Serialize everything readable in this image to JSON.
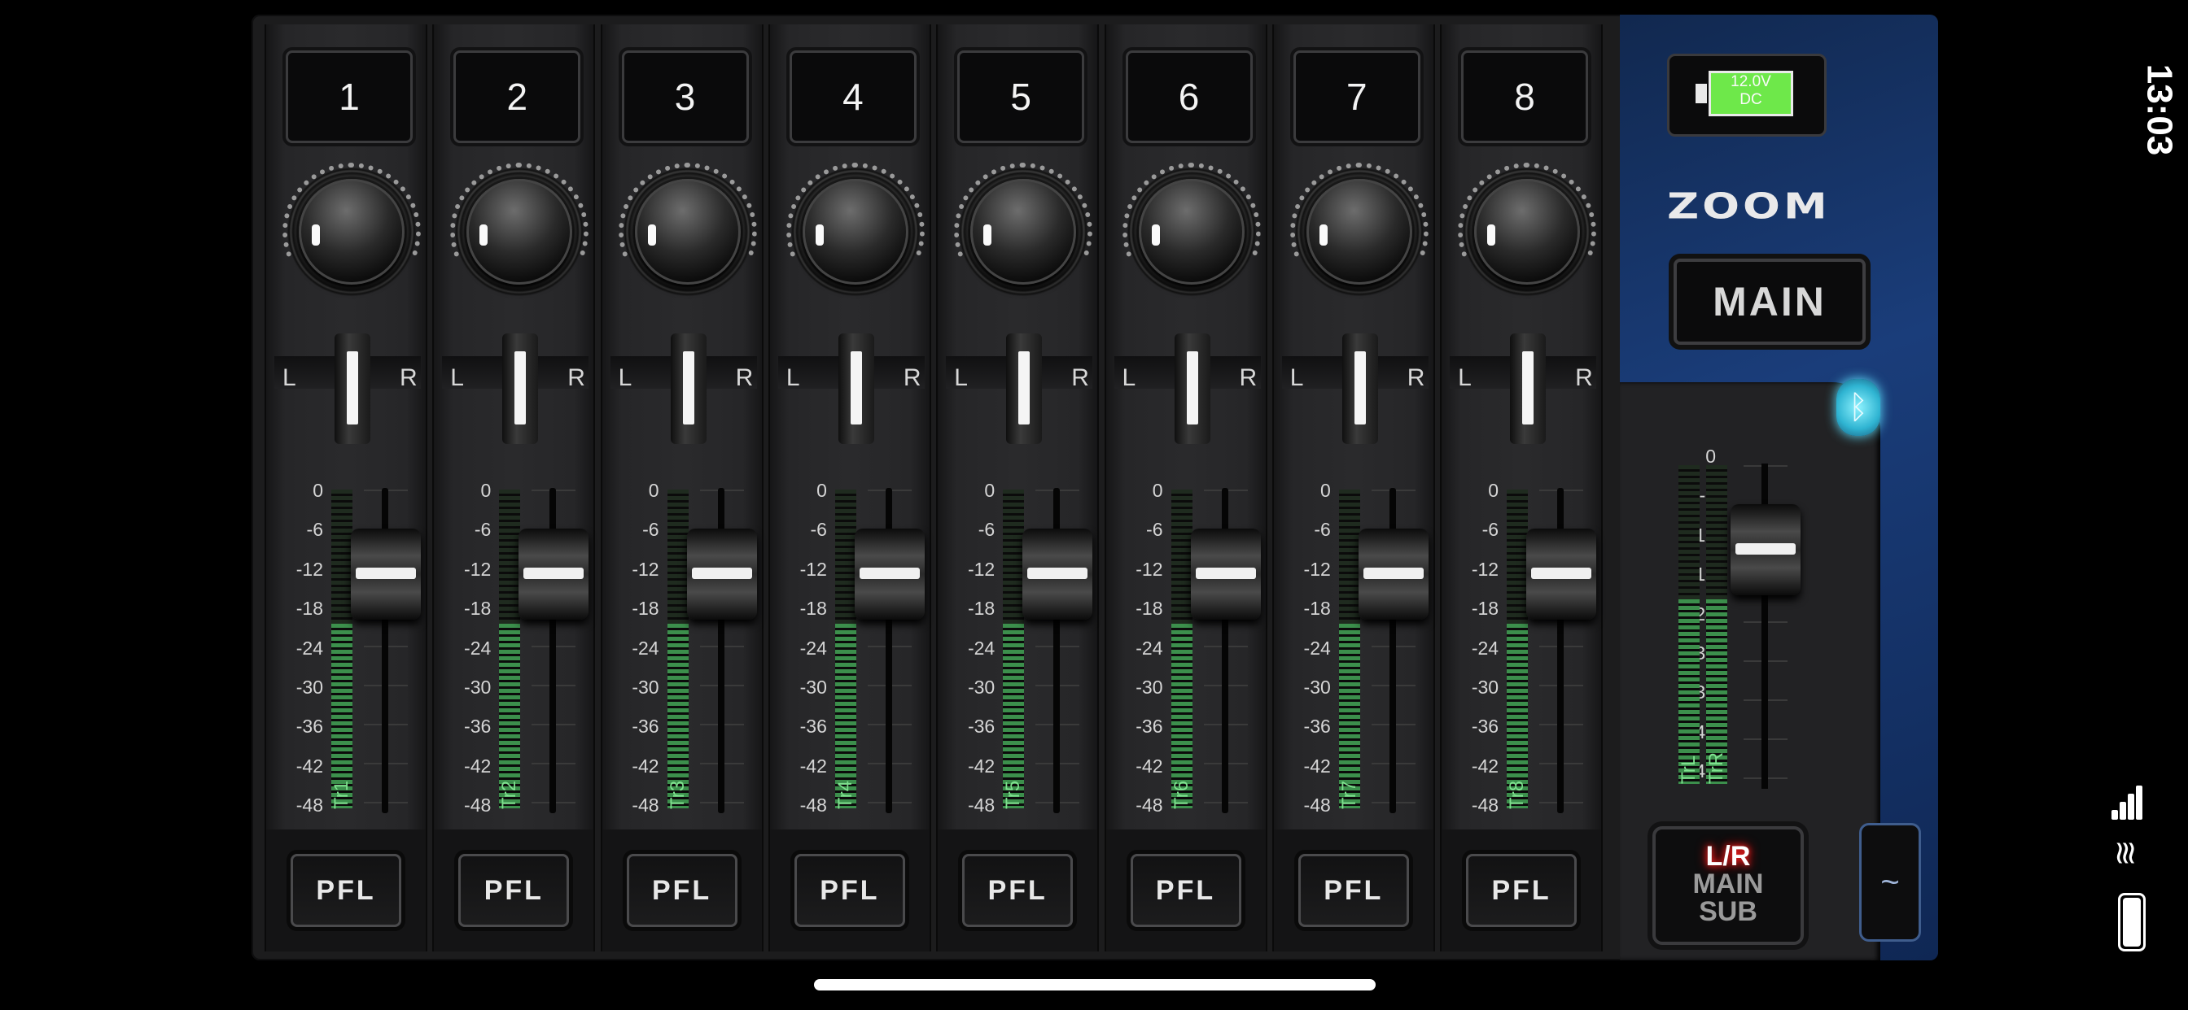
{
  "channels": [
    {
      "name": "1",
      "track": "Tr1",
      "fader_level": 0.2
    },
    {
      "name": "2",
      "track": "Tr2",
      "fader_level": 0.2
    },
    {
      "name": "3",
      "track": "Tr3",
      "fader_level": 0.2
    },
    {
      "name": "4",
      "track": "Tr4",
      "fader_level": 0.2
    },
    {
      "name": "5",
      "track": "Tr5",
      "fader_level": 0.2
    },
    {
      "name": "6",
      "track": "Tr6",
      "fader_level": 0.2
    },
    {
      "name": "7",
      "track": "Tr7",
      "fader_level": 0.2
    },
    {
      "name": "8",
      "track": "Tr8",
      "fader_level": 0.2
    }
  ],
  "meter_levels": [
    0.58,
    0.58,
    0.58,
    0.58,
    0.58,
    0.58,
    0.58,
    0.58
  ],
  "pan": {
    "left_label": "L",
    "right_label": "R"
  },
  "scale": [
    "0",
    "-6",
    "-12",
    "-18",
    "-24",
    "-30",
    "-36",
    "-42",
    "-48"
  ],
  "pfl_label": "PFL",
  "master": {
    "battery_text": "12.0V\nDC",
    "logo": "ZOOM",
    "main_label": "MAIN",
    "bluetooth_icon": "bluetooth-icon",
    "tracks": [
      "TrL",
      "TrR"
    ],
    "meter_levels": [
      0.58,
      0.58
    ],
    "fader_level": 0.2,
    "output_lines": [
      "L/R",
      "MAIN",
      "SUB"
    ],
    "drawer_icon": "~"
  },
  "status": {
    "time": "13:03"
  },
  "colors": {
    "meter_green": "#3c8f4c",
    "track_label": "#7ee08e",
    "master_panel": "#1a3d7a",
    "battery_green": "#6ee84a",
    "lr_glow": "#ff2a2a"
  }
}
